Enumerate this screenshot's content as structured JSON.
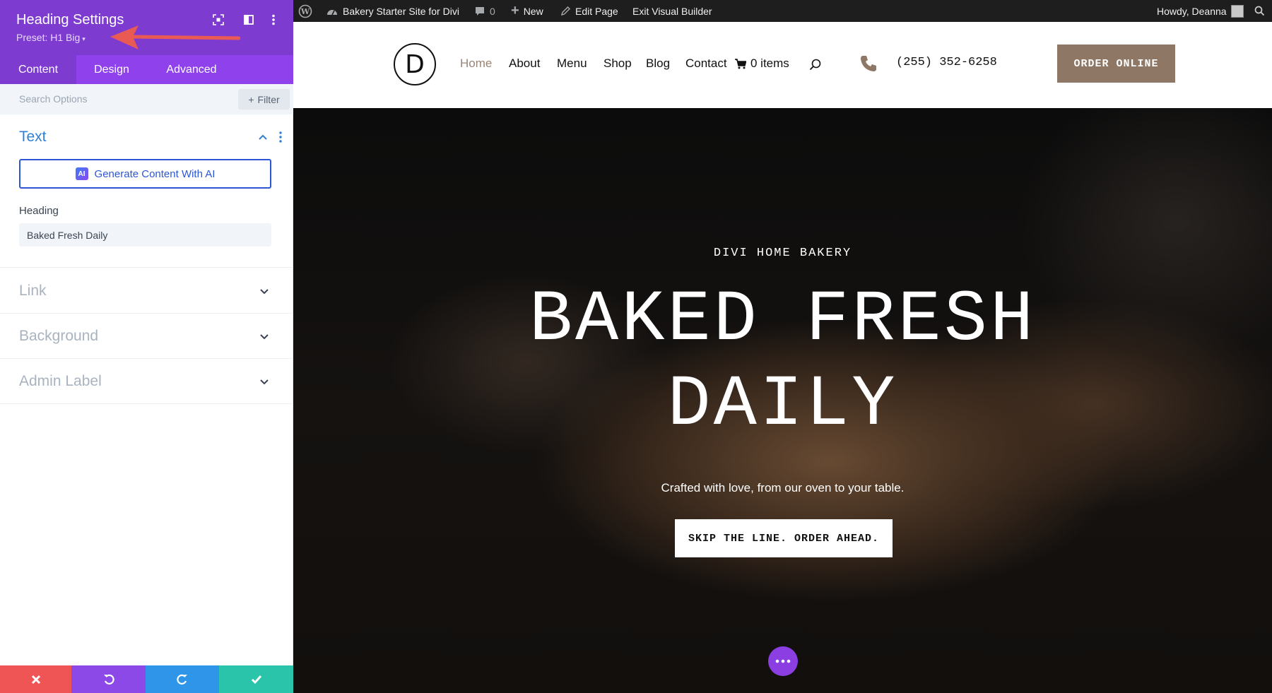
{
  "panel": {
    "title": "Heading Settings",
    "preset": "Preset: H1 Big",
    "tabs": [
      {
        "label": "Content"
      },
      {
        "label": "Design"
      },
      {
        "label": "Advanced"
      }
    ],
    "search_placeholder": "Search Options",
    "filter_label": "Filter",
    "text_section": {
      "title": "Text",
      "ai_button": "Generate Content With AI",
      "ai_badge": "AI",
      "heading_label": "Heading",
      "heading_value": "Baked Fresh Daily"
    },
    "sections": [
      {
        "title": "Link"
      },
      {
        "title": "Background"
      },
      {
        "title": "Admin Label"
      }
    ],
    "colors": {
      "header": "#7e3bd0",
      "tabs": "#8f42ec",
      "accent": "#2b56d6",
      "close": "#ef5555",
      "undo": "#8d49e8",
      "redo": "#2f95e8",
      "save": "#29c4a9"
    }
  },
  "admin_bar": {
    "site_name": "Bakery Starter Site for Divi",
    "comments_count": "0",
    "new_label": "New",
    "edit_label": "Edit Page",
    "exit_label": "Exit Visual Builder",
    "howdy": "Howdy, Deanna"
  },
  "site": {
    "logo_letter": "D",
    "nav": [
      {
        "label": "Home"
      },
      {
        "label": "About"
      },
      {
        "label": "Menu"
      },
      {
        "label": "Shop"
      },
      {
        "label": "Blog"
      },
      {
        "label": "Contact"
      }
    ],
    "cart": "0 items",
    "phone": "(255) 352-6258",
    "order_button": "ORDER ONLINE",
    "accent_color": "#8f7766"
  },
  "hero": {
    "subtitle": "DIVI HOME BAKERY",
    "title_line1": "BAKED FRESH",
    "title_line2": "DAILY",
    "tagline": "Crafted with love, from our oven to your table.",
    "button": "SKIP THE LINE. ORDER AHEAD."
  }
}
